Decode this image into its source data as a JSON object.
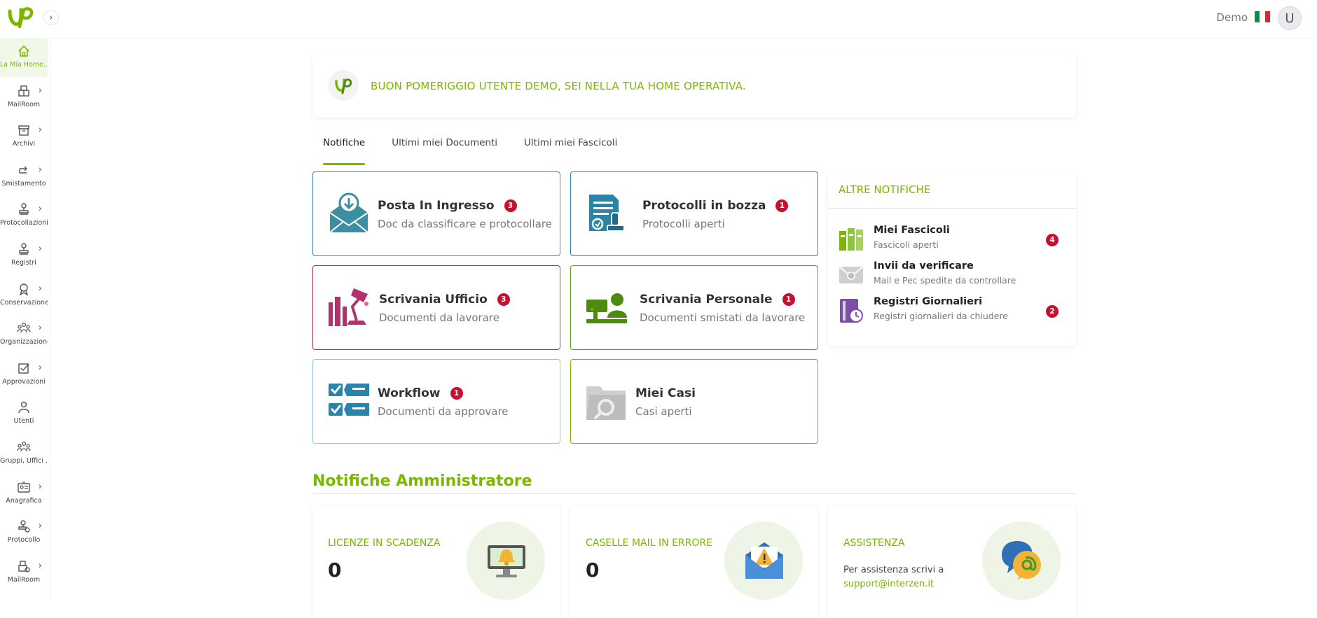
{
  "header": {
    "user_name": "Demo",
    "avatar_initial": "U",
    "collapse_glyph": "›",
    "language_flag": "italian-flag-icon"
  },
  "colors": {
    "brand_green": "#7ab800",
    "badge_red": "#c8102e",
    "teal": "#3b8fa0",
    "magenta": "#b0336a",
    "light_blue": "#8cc6e6"
  },
  "sidebar": {
    "items": [
      {
        "label": "La Mia Home...",
        "icon": "home-icon",
        "chevron": ""
      },
      {
        "label": "MailRoom",
        "icon": "mailroom-icon",
        "chevron": "›"
      },
      {
        "label": "Archivi",
        "icon": "archive-icon",
        "chevron": "›"
      },
      {
        "label": "Smistamento",
        "icon": "forward-icon",
        "chevron": "›"
      },
      {
        "label": "Protocollazioni",
        "icon": "stamp-icon",
        "chevron": "›"
      },
      {
        "label": "Registri",
        "icon": "stamp-icon",
        "chevron": "›"
      },
      {
        "label": "Conservazione",
        "icon": "award-icon",
        "chevron": "›"
      },
      {
        "label": "Organizzazione",
        "icon": "people-icon",
        "chevron": "›"
      },
      {
        "label": "Approvazioni",
        "icon": "checkbox-icon",
        "chevron": "›"
      },
      {
        "label": "Utenti",
        "icon": "user-icon",
        "chevron": ""
      },
      {
        "label": "Gruppi, Uffici ...",
        "icon": "group-icon",
        "chevron": ""
      },
      {
        "label": "Anagrafica",
        "icon": "id-card-icon",
        "chevron": "›"
      },
      {
        "label": "Protocollo",
        "icon": "stamp-gear-icon",
        "chevron": "›"
      },
      {
        "label": "MailRoom",
        "icon": "mailroom-gear-icon",
        "chevron": "›"
      }
    ]
  },
  "greeting": {
    "text": "BUON POMERIGGIO UTENTE DEMO, SEI NELLA TUA HOME OPERATIVA."
  },
  "tabs": [
    {
      "label": "Notifiche"
    },
    {
      "label": "Ultimi miei Documenti"
    },
    {
      "label": "Ultimi miei Fascicoli"
    }
  ],
  "cards": [
    {
      "title": "Posta In Ingresso",
      "subtitle": "Doc da classificare e protocollare",
      "badge": "3",
      "icon": "mail-inbox-icon"
    },
    {
      "title": "Protocolli in bozza",
      "subtitle": "Protocolli aperti",
      "badge": "1",
      "icon": "document-stamp-icon"
    },
    {
      "title": "Scrivania Ufficio",
      "subtitle": "Documenti da lavorare",
      "badge": "3",
      "icon": "desk-lamp-icon"
    },
    {
      "title": "Scrivania Personale",
      "subtitle": "Documenti smistati da lavorare",
      "badge": "1",
      "icon": "person-desk-icon"
    },
    {
      "title": "Workflow",
      "subtitle": "Documenti da approvare",
      "badge": "1",
      "icon": "checklist-icon"
    },
    {
      "title": "Miei Casi",
      "subtitle": "Casi aperti",
      "badge": "",
      "icon": "folder-search-icon"
    }
  ],
  "altre": {
    "title": "ALTRE NOTIFICHE",
    "items": [
      {
        "title": "Miei Fascicoli",
        "subtitle": "Fascicoli aperti",
        "badge": "4",
        "icon": "binders-icon"
      },
      {
        "title": "Invii da verificare",
        "subtitle": "Mail e Pec spedite da controllare",
        "badge": "",
        "icon": "envelope-check-icon"
      },
      {
        "title": "Registri Giornalieri",
        "subtitle": "Registri giornalieri da chiudere",
        "badge": "2",
        "icon": "register-clock-icon"
      }
    ]
  },
  "admin": {
    "title": "Notifiche Amministratore",
    "cards": [
      {
        "title": "LICENZE IN SCADENZA",
        "value": "0",
        "icon": "monitor-bell-icon"
      },
      {
        "title": "CASELLE MAIL IN ERRORE",
        "value": "0",
        "icon": "mail-warning-icon"
      },
      {
        "title": "ASSISTENZA",
        "text": "Per assistenza scrivi a",
        "link": "support@interzen.it",
        "icon": "chat-at-icon"
      }
    ]
  }
}
